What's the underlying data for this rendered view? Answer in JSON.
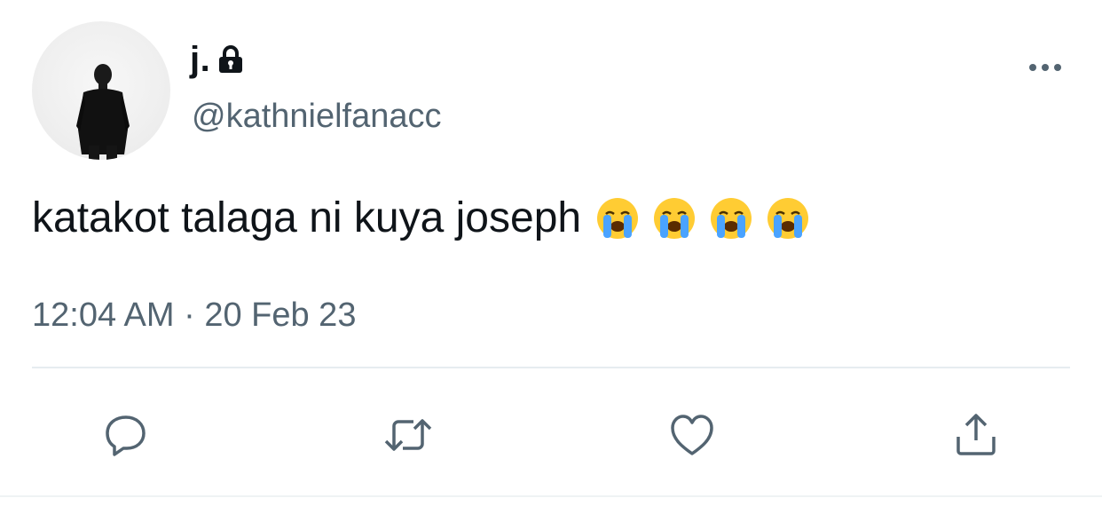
{
  "author": {
    "display_name": "j.",
    "handle": "@kathnielfanacc",
    "protected_icon": "lock-icon",
    "avatar": "person-in-suit-back-view"
  },
  "tweet": {
    "text": "katakot talaga ni kuya joseph",
    "emojis": [
      "loudly-crying-face",
      "loudly-crying-face",
      "loudly-crying-face",
      "loudly-crying-face"
    ],
    "timestamp": "12:04 AM · 20 Feb 23"
  },
  "actions": {
    "more": "more-icon",
    "reply": "reply-icon",
    "retweet": "retweet-icon",
    "like": "heart-icon",
    "share": "share-icon"
  },
  "colors": {
    "text_primary": "#0f1419",
    "text_secondary": "#536471",
    "icon": "#536471",
    "divider": "#e6ecf0"
  }
}
